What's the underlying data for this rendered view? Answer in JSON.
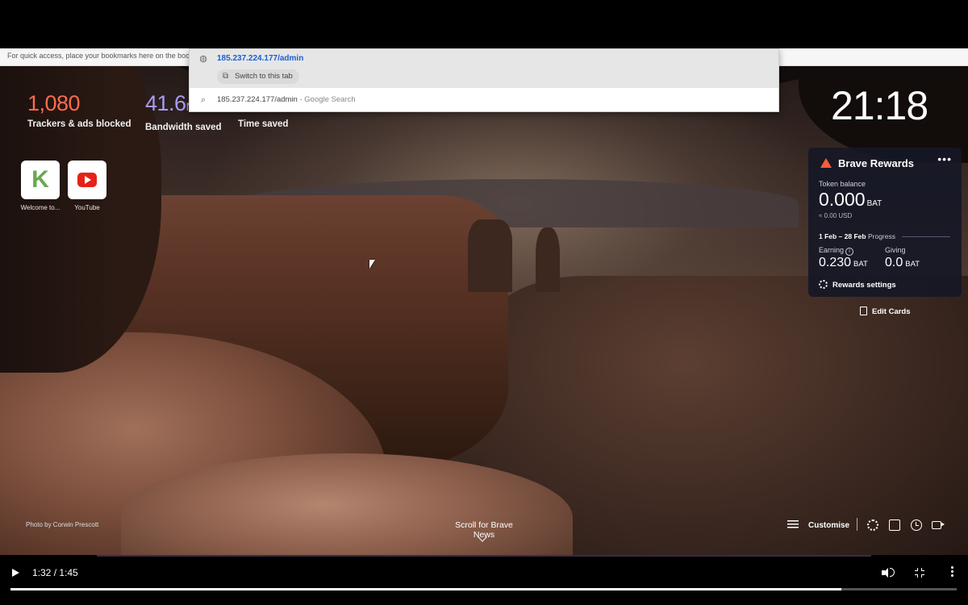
{
  "bookmarks_bar": {
    "hint": "For quick access, place your bookmarks here on the bookm"
  },
  "omnibox": {
    "suggestion_url": "185.237.224.177/admin",
    "switch_tab_label": "Switch to this tab",
    "search_query": "185.237.224.177/admin",
    "search_suffix": " - Google Search",
    "icons": {
      "url": "globe-icon",
      "switch": "tab-icon",
      "search": "search-icon"
    }
  },
  "stats": {
    "trackers": {
      "value": "1,080",
      "label": "Trackers & ads blocked",
      "color": "#ff6b4f"
    },
    "bandwidth": {
      "value": "41.6",
      "unit": "M",
      "label": "Bandwidth saved",
      "color": "#a89cf7"
    },
    "time": {
      "label": "Time saved"
    }
  },
  "top_sites": [
    {
      "letter": "K",
      "label": "Welcome to...",
      "icon": "k-logo"
    },
    {
      "label": "YouTube",
      "icon": "youtube-icon"
    }
  ],
  "clock": {
    "time": "21:18"
  },
  "rewards": {
    "title": "Brave Rewards",
    "menu": "•••",
    "token_label": "Token balance",
    "token_balance": "0.000",
    "token_unit": "BAT",
    "token_usd": "≈ 0.00 USD",
    "progress_range": "1 Feb – 28 Feb",
    "progress_label": "Progress",
    "earning_label": "Earning",
    "earning_value": "0.230",
    "giving_label": "Giving",
    "giving_value": "0.0",
    "unit": "BAT",
    "settings_label": "Rewards settings",
    "accent": "#ff5a3c"
  },
  "edit_cards": {
    "label": "Edit Cards"
  },
  "bottom": {
    "photo_credit": "Photo by Corwin Prescott",
    "scroll_news": "Scroll for Brave News",
    "customise": "Customise",
    "icons": [
      "settings-icon",
      "bookmark-icon",
      "history-icon",
      "video-icon"
    ]
  },
  "player": {
    "time": "1:32 / 1:45",
    "progress_fraction": 0.878,
    "icons": [
      "play-icon",
      "volume-icon",
      "exit-fullscreen-icon",
      "more-icon"
    ]
  }
}
